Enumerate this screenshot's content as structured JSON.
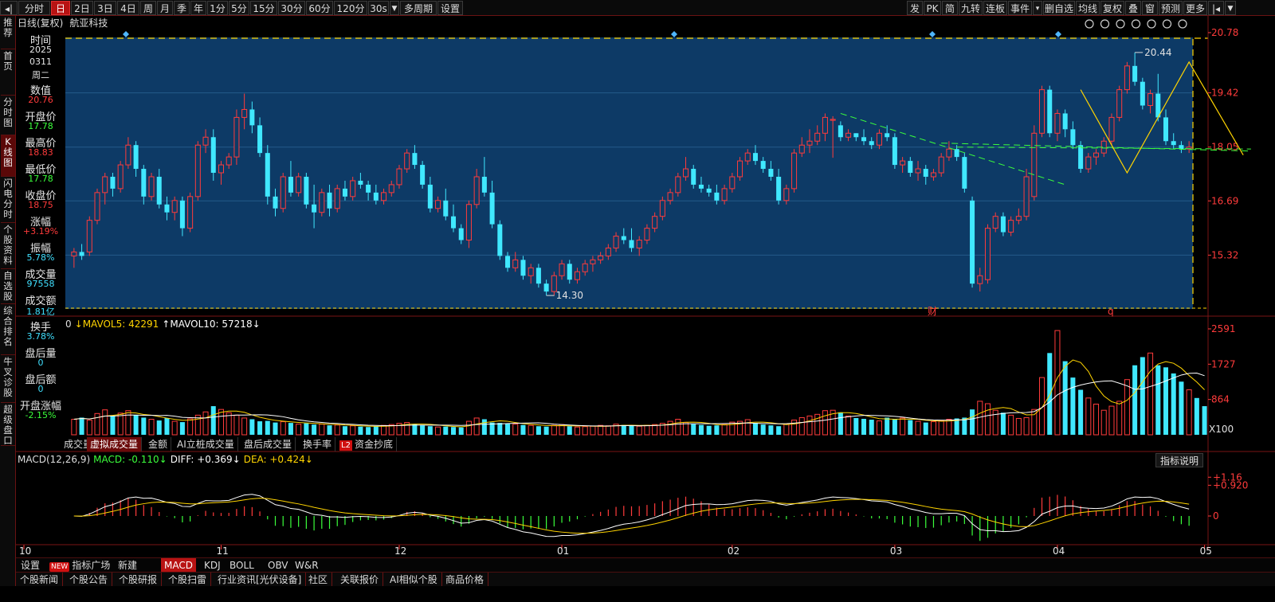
{
  "toolbar": {
    "left_items": [
      "分时",
      "日",
      "2日",
      "3日",
      "4日",
      "周",
      "月",
      "季",
      "年",
      "1分",
      "5分",
      "15分",
      "30分",
      "60分",
      "120分",
      "30s",
      "多周期",
      "设置"
    ],
    "active_period": "日",
    "right_items": [
      "发",
      "PK",
      "简",
      "九转",
      "连板",
      "事件",
      "▾",
      "删自选",
      "均线",
      "复权",
      "叠",
      "窗",
      "预测",
      "更多"
    ],
    "nav_icons": [
      "step-back-icon",
      "dropdown-icon"
    ]
  },
  "left_tabs": [
    {
      "label": "推荐"
    },
    {
      "label": "首页"
    },
    {
      "label": "分时图"
    },
    {
      "label": "K线图",
      "active": true
    },
    {
      "label": "闪电分时"
    },
    {
      "label": "个股资料"
    },
    {
      "label": "自选股"
    },
    {
      "label": "综合排名"
    },
    {
      "label": "牛叉诊股"
    },
    {
      "label": "超级盘口"
    }
  ],
  "chart_title": {
    "kind": "日线(复权)",
    "name": "航亚科技"
  },
  "info_panel": [
    {
      "label": "时间",
      "values": [
        "2025",
        "0311",
        "周二"
      ],
      "color": "#e6e6e6"
    },
    {
      "label": "数值",
      "values": [
        "20.76"
      ],
      "color": "#ff3b3b"
    },
    {
      "label": "开盘价",
      "values": [
        "17.78"
      ],
      "color": "#3bff3b"
    },
    {
      "label": "最高价",
      "values": [
        "18.83"
      ],
      "color": "#ff3b3b"
    },
    {
      "label": "最低价",
      "values": [
        "17.78"
      ],
      "color": "#3bff3b"
    },
    {
      "label": "收盘价",
      "values": [
        "18.75"
      ],
      "color": "#ff3b3b"
    },
    {
      "label": "涨幅",
      "values": [
        "+3.19%"
      ],
      "color": "#ff3b3b"
    },
    {
      "label": "振幅",
      "values": [
        "5.78%"
      ],
      "color": "#40e0ff"
    },
    {
      "label": "成交量",
      "values": [
        "97558"
      ],
      "color": "#40e0ff"
    },
    {
      "label": "成交额",
      "values": [
        "1.81亿"
      ],
      "color": "#40e0ff"
    },
    {
      "label": "换手",
      "values": [
        "3.78%"
      ],
      "color": "#40e0ff"
    },
    {
      "label": "盘后量",
      "values": [
        "0"
      ],
      "color": "#40e0ff"
    },
    {
      "label": "盘后额",
      "values": [
        "0"
      ],
      "color": "#40e0ff"
    },
    {
      "label": "开盘涨幅",
      "values": [
        "-2.15%"
      ],
      "color": "#3bff3b"
    }
  ],
  "price_axis": {
    "ticks": [
      "20.78",
      "19.42",
      "18.05",
      "16.69",
      "15.32"
    ],
    "min": 14.0,
    "max": 20.78
  },
  "price_annotations": {
    "high_label": "20.44",
    "low_label": "14.30",
    "event_labels": [
      "财",
      "q"
    ]
  },
  "candles": [
    [
      15.3,
      15.5,
      15.0,
      15.4
    ],
    [
      15.4,
      15.6,
      15.2,
      15.3
    ],
    [
      15.4,
      16.3,
      15.3,
      16.2
    ],
    [
      16.2,
      17.0,
      16.1,
      16.9
    ],
    [
      16.9,
      17.4,
      16.6,
      17.3
    ],
    [
      17.3,
      17.4,
      16.8,
      17.0
    ],
    [
      17.0,
      17.7,
      16.9,
      17.6
    ],
    [
      17.6,
      18.3,
      17.5,
      18.1
    ],
    [
      18.1,
      18.2,
      17.3,
      17.5
    ],
    [
      17.5,
      17.6,
      16.6,
      16.8
    ],
    [
      16.8,
      17.4,
      16.7,
      17.3
    ],
    [
      17.3,
      17.5,
      16.5,
      16.6
    ],
    [
      16.6,
      16.8,
      16.2,
      16.4
    ],
    [
      16.4,
      16.8,
      16.2,
      16.7
    ],
    [
      16.7,
      16.8,
      15.8,
      16.0
    ],
    [
      16.0,
      16.9,
      15.9,
      16.8
    ],
    [
      16.8,
      18.2,
      16.7,
      18.1
    ],
    [
      18.1,
      18.5,
      17.9,
      18.3
    ],
    [
      18.3,
      18.5,
      17.2,
      17.4
    ],
    [
      17.4,
      17.7,
      17.1,
      17.6
    ],
    [
      17.6,
      17.9,
      17.5,
      17.8
    ],
    [
      17.8,
      19.0,
      17.6,
      18.8
    ],
    [
      18.8,
      19.4,
      18.5,
      19.0
    ],
    [
      19.0,
      19.2,
      18.4,
      18.6
    ],
    [
      18.6,
      18.8,
      17.8,
      17.9
    ],
    [
      17.9,
      18.1,
      16.6,
      16.8
    ],
    [
      16.8,
      17.0,
      16.3,
      16.5
    ],
    [
      16.5,
      17.4,
      16.4,
      17.3
    ],
    [
      17.3,
      17.7,
      16.8,
      16.9
    ],
    [
      16.9,
      17.4,
      16.8,
      17.3
    ],
    [
      17.3,
      17.4,
      16.5,
      16.6
    ],
    [
      16.6,
      17.1,
      16.0,
      16.4
    ],
    [
      16.4,
      17.0,
      16.3,
      16.9
    ],
    [
      16.9,
      17.1,
      16.3,
      16.5
    ],
    [
      16.5,
      17.1,
      16.4,
      17.0
    ],
    [
      17.0,
      17.2,
      16.7,
      16.8
    ],
    [
      16.8,
      17.3,
      16.7,
      17.2
    ],
    [
      17.2,
      17.4,
      17.0,
      17.1
    ],
    [
      17.1,
      17.2,
      16.7,
      16.9
    ],
    [
      16.9,
      17.1,
      16.6,
      16.7
    ],
    [
      16.7,
      17.0,
      16.6,
      16.9
    ],
    [
      16.9,
      17.2,
      16.8,
      17.1
    ],
    [
      17.1,
      17.6,
      17.0,
      17.5
    ],
    [
      17.5,
      18.0,
      17.4,
      17.9
    ],
    [
      17.9,
      18.1,
      17.5,
      17.6
    ],
    [
      17.6,
      17.7,
      17.0,
      17.1
    ],
    [
      17.1,
      17.3,
      16.4,
      16.5
    ],
    [
      16.5,
      16.8,
      16.4,
      16.7
    ],
    [
      16.7,
      17.0,
      16.2,
      16.3
    ],
    [
      16.3,
      16.6,
      15.9,
      16.0
    ],
    [
      16.0,
      16.1,
      15.6,
      15.7
    ],
    [
      15.7,
      16.7,
      15.5,
      16.6
    ],
    [
      16.6,
      17.5,
      16.5,
      17.3
    ],
    [
      17.3,
      17.8,
      16.8,
      16.9
    ],
    [
      16.9,
      17.2,
      16.0,
      16.1
    ],
    [
      16.1,
      16.2,
      15.2,
      15.3
    ],
    [
      15.3,
      15.4,
      14.9,
      15.0
    ],
    [
      15.0,
      15.4,
      14.9,
      15.2
    ],
    [
      15.2,
      15.3,
      14.7,
      14.8
    ],
    [
      14.8,
      15.1,
      14.6,
      15.0
    ],
    [
      15.0,
      15.1,
      14.5,
      14.6
    ],
    [
      14.6,
      14.7,
      14.3,
      14.4
    ],
    [
      14.4,
      14.9,
      14.3,
      14.8
    ],
    [
      14.8,
      15.2,
      14.7,
      15.1
    ],
    [
      15.1,
      15.2,
      14.6,
      14.7
    ],
    [
      14.7,
      15.0,
      14.6,
      14.9
    ],
    [
      14.9,
      15.2,
      14.8,
      15.1
    ],
    [
      15.1,
      15.3,
      14.9,
      15.2
    ],
    [
      15.2,
      15.4,
      15.1,
      15.3
    ],
    [
      15.3,
      15.6,
      15.2,
      15.5
    ],
    [
      15.5,
      15.9,
      15.4,
      15.8
    ],
    [
      15.8,
      16.0,
      15.6,
      15.7
    ],
    [
      15.7,
      16.0,
      15.4,
      15.5
    ],
    [
      15.5,
      15.8,
      15.3,
      15.7
    ],
    [
      15.7,
      16.1,
      15.6,
      16.0
    ],
    [
      16.0,
      16.4,
      15.9,
      16.3
    ],
    [
      16.3,
      16.8,
      16.2,
      16.7
    ],
    [
      16.7,
      17.0,
      16.6,
      16.9
    ],
    [
      16.9,
      17.4,
      16.8,
      17.3
    ],
    [
      17.3,
      17.8,
      17.2,
      17.5
    ],
    [
      17.5,
      17.6,
      17.0,
      17.1
    ],
    [
      17.1,
      17.3,
      16.9,
      17.0
    ],
    [
      17.0,
      17.1,
      16.8,
      16.9
    ],
    [
      16.9,
      17.1,
      16.6,
      16.7
    ],
    [
      16.7,
      17.1,
      16.6,
      17.0
    ],
    [
      17.0,
      17.4,
      16.9,
      17.3
    ],
    [
      17.3,
      17.8,
      17.2,
      17.7
    ],
    [
      17.7,
      18.0,
      17.6,
      17.9
    ],
    [
      17.9,
      18.1,
      17.6,
      17.7
    ],
    [
      17.7,
      17.8,
      17.4,
      17.5
    ],
    [
      17.5,
      17.7,
      17.2,
      17.3
    ],
    [
      17.3,
      17.5,
      16.6,
      16.7
    ],
    [
      16.7,
      17.1,
      16.6,
      17.0
    ],
    [
      17.0,
      18.0,
      16.9,
      17.9
    ],
    [
      17.9,
      18.3,
      17.8,
      18.1
    ],
    [
      18.1,
      18.5,
      17.9,
      18.2
    ],
    [
      18.2,
      18.6,
      18.1,
      18.4
    ],
    [
      18.4,
      18.9,
      18.2,
      18.8
    ],
    [
      18.75,
      18.83,
      17.78,
      18.75
    ],
    [
      18.6,
      18.7,
      18.2,
      18.3
    ],
    [
      18.3,
      18.5,
      18.2,
      18.4
    ],
    [
      18.4,
      18.4,
      18.2,
      18.3
    ],
    [
      18.3,
      18.5,
      18.1,
      18.2
    ],
    [
      18.2,
      18.3,
      18.0,
      18.1
    ],
    [
      18.1,
      18.5,
      18.0,
      18.4
    ],
    [
      18.4,
      18.6,
      18.2,
      18.3
    ],
    [
      18.3,
      18.4,
      17.5,
      17.6
    ],
    [
      17.6,
      17.8,
      17.4,
      17.7
    ],
    [
      17.7,
      17.8,
      17.3,
      17.4
    ],
    [
      17.4,
      17.7,
      17.2,
      17.5
    ],
    [
      17.5,
      17.6,
      17.1,
      17.3
    ],
    [
      17.3,
      17.5,
      17.2,
      17.4
    ],
    [
      17.4,
      17.9,
      17.3,
      17.8
    ],
    [
      17.8,
      18.2,
      17.7,
      18.0
    ],
    [
      18.0,
      18.1,
      17.7,
      17.8
    ],
    [
      17.8,
      17.9,
      16.9,
      17.0
    ],
    [
      16.7,
      16.8,
      14.5,
      14.6
    ],
    [
      14.6,
      15.0,
      14.4,
      14.8
    ],
    [
      14.7,
      16.1,
      14.6,
      16.0
    ],
    [
      16.0,
      16.4,
      15.9,
      16.3
    ],
    [
      16.3,
      16.4,
      15.8,
      15.9
    ],
    [
      15.9,
      16.3,
      15.8,
      16.2
    ],
    [
      16.2,
      16.5,
      16.1,
      16.3
    ],
    [
      16.3,
      17.5,
      16.2,
      17.3
    ],
    [
      16.8,
      18.6,
      16.7,
      18.4
    ],
    [
      18.4,
      19.6,
      18.3,
      19.5
    ],
    [
      19.5,
      19.6,
      18.3,
      18.4
    ],
    [
      18.4,
      19.0,
      18.2,
      18.9
    ],
    [
      18.9,
      19.0,
      18.3,
      18.5
    ],
    [
      18.5,
      18.7,
      18.0,
      18.1
    ],
    [
      18.1,
      18.2,
      17.4,
      17.5
    ],
    [
      17.5,
      17.9,
      17.4,
      17.8
    ],
    [
      17.8,
      18.0,
      17.6,
      17.9
    ],
    [
      17.9,
      18.3,
      17.8,
      18.2
    ],
    [
      18.2,
      18.9,
      18.1,
      18.8
    ],
    [
      18.8,
      19.6,
      18.7,
      19.5
    ],
    [
      19.5,
      20.2,
      19.4,
      20.1
    ],
    [
      20.1,
      20.44,
      19.6,
      19.7
    ],
    [
      19.7,
      19.8,
      19.0,
      19.1
    ],
    [
      19.1,
      19.5,
      18.9,
      19.4
    ],
    [
      19.4,
      19.9,
      18.7,
      18.8
    ],
    [
      18.8,
      19.0,
      18.1,
      18.2
    ],
    [
      18.2,
      18.4,
      18.0,
      18.1
    ],
    [
      18.1,
      18.2,
      17.9,
      18.0
    ],
    [
      18.0,
      18.2,
      17.9,
      18.05
    ]
  ],
  "volume": {
    "legend": [
      {
        "text": "0",
        "color": "#dddddd"
      },
      {
        "text": "↓MAVOL5: 42291",
        "color": "#ffd400"
      },
      {
        "text": "↑MAVOL10: 57218↓",
        "color": "#ffffff"
      }
    ],
    "axis_ticks": [
      "2591",
      "1727",
      "864",
      "X100"
    ],
    "values": [
      380,
      420,
      360,
      520,
      610,
      460,
      530,
      590,
      480,
      420,
      380,
      350,
      410,
      330,
      310,
      390,
      480,
      560,
      700,
      620,
      540,
      480,
      410,
      380,
      330,
      340,
      300,
      320,
      290,
      260,
      280,
      250,
      260,
      230,
      240,
      210,
      220,
      200,
      190,
      210,
      230,
      250,
      280,
      300,
      260,
      230,
      210,
      190,
      200,
      190,
      180,
      330,
      410,
      380,
      300,
      290,
      270,
      260,
      240,
      230,
      210,
      200,
      230,
      250,
      210,
      190,
      200,
      210,
      230,
      220,
      260,
      240,
      220,
      210,
      230,
      250,
      280,
      330,
      380,
      300,
      260,
      240,
      220,
      230,
      250,
      310,
      330,
      370,
      290,
      250,
      230,
      210,
      260,
      360,
      420,
      460,
      500,
      590,
      600,
      550,
      460,
      410,
      390,
      370,
      340,
      420,
      380,
      410,
      360,
      330,
      300,
      320,
      350,
      380,
      400,
      420,
      620,
      820,
      760,
      600,
      540,
      480,
      400,
      420,
      620,
      1400,
      2000,
      2550,
      1800,
      1400,
      1100,
      900,
      750,
      600,
      700,
      820,
      1350,
      1700,
      1900,
      2000,
      1700,
      1650,
      1500,
      1300,
      1100,
      900,
      700
    ],
    "max": 2591
  },
  "sub_tabs": [
    {
      "label": "成交量",
      "active": false
    },
    {
      "label": "虚拟成交量",
      "active": true
    },
    {
      "label": "金额",
      "active": false
    },
    {
      "label": "AI立桩成交量",
      "active": false
    },
    {
      "label": "盘后成交量",
      "active": false
    },
    {
      "label": "换手率",
      "active": false
    },
    {
      "label": "资金抄底",
      "active": false,
      "badge": "L2"
    }
  ],
  "macd": {
    "legend": [
      {
        "text": "MACD(12,26,9)",
        "color": "#dddddd"
      },
      {
        "text": "MACD: -0.110↓",
        "color": "#3bff3b"
      },
      {
        "text": "DIFF: +0.369↓",
        "color": "#ffffff"
      },
      {
        "text": "DEA: +0.424↓",
        "color": "#ffd400"
      }
    ],
    "axis_ticks": [
      "1.16",
      "0.920",
      "0"
    ],
    "explain_label": "指标说明"
  },
  "months": [
    "10",
    "11",
    "12",
    "01",
    "02",
    "03",
    "04",
    "05"
  ],
  "toolrow": [
    {
      "label": "设置"
    },
    {
      "label": "指标广场",
      "badge": "NEW"
    },
    {
      "label": "新建"
    },
    {
      "label": "MACD",
      "active": true
    },
    {
      "label": "KDJ"
    },
    {
      "label": "BOLL"
    },
    {
      "label": "OBV"
    },
    {
      "label": "W&R"
    }
  ],
  "news_tabs": [
    "个股新闻",
    "个股公告",
    "个股研报",
    "个股扫雷",
    "行业资讯[光伏设备]",
    "社区",
    "关联报价",
    "AI相似个股",
    "商品价格"
  ],
  "colors": {
    "up": "#ff3b3b",
    "down": "#40e8ff",
    "chartBg": "#0d3a66",
    "ma5": "#ffd400",
    "ma10": "#ffffff",
    "trendGreen": "#3bff3b",
    "dash": "#ffd400"
  }
}
